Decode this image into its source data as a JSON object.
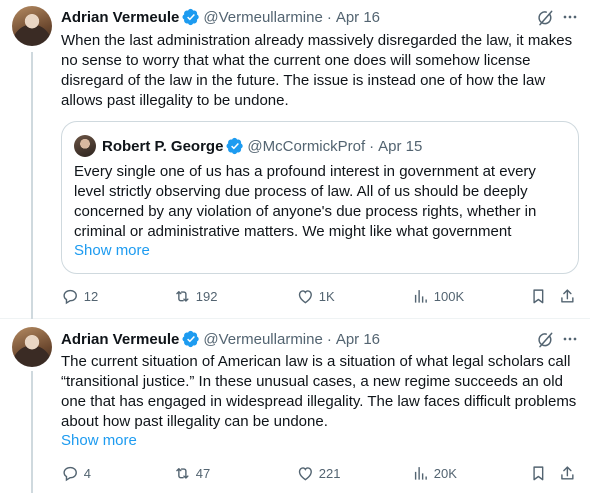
{
  "colors": {
    "link": "#1d9bf0",
    "secondary": "#536471",
    "verified": "#1d9bf0"
  },
  "tweets": [
    {
      "author": {
        "name": "Adrian Vermeule",
        "handle": "@Vermeullarmine",
        "verified": true
      },
      "separator": "·",
      "date": "Apr 16",
      "text": "When the last administration already massively disregarded the law, it makes no sense to worry that what the current one does will somehow license disregard of the law in the future. The issue is instead one of how the law allows past illegality to be undone.",
      "quote": {
        "author": {
          "name": "Robert P. George",
          "handle": "@McCormickProf",
          "verified": true
        },
        "date": "Apr 15",
        "text": "Every single one of us has a profound interest in government at every level strictly observing due process of law. All of us should be deeply concerned by any violation of anyone's due process rights, whether in criminal or administrative matters. We might like what government",
        "show_more": "Show more"
      },
      "stats": {
        "replies": "12",
        "reposts": "192",
        "likes": "1K",
        "views": "100K"
      },
      "icons": [
        "grok-icon",
        "more-icon",
        "reply-icon",
        "repost-icon",
        "like-icon",
        "views-icon",
        "bookmark-icon",
        "share-icon"
      ]
    },
    {
      "author": {
        "name": "Adrian Vermeule",
        "handle": "@Vermeullarmine",
        "verified": true
      },
      "separator": "·",
      "date": "Apr 16",
      "text": "The current situation of American law is a situation of what legal scholars call “transitional justice.” In these unusual cases, a new regime succeeds an old one that has engaged in widespread illegality. The law faces difficult problems about how past illegality can be undone.",
      "show_more": "Show more",
      "stats": {
        "replies": "4",
        "reposts": "47",
        "likes": "221",
        "views": "20K"
      },
      "icons": [
        "grok-icon",
        "more-icon",
        "reply-icon",
        "repost-icon",
        "like-icon",
        "views-icon",
        "bookmark-icon",
        "share-icon"
      ]
    }
  ]
}
